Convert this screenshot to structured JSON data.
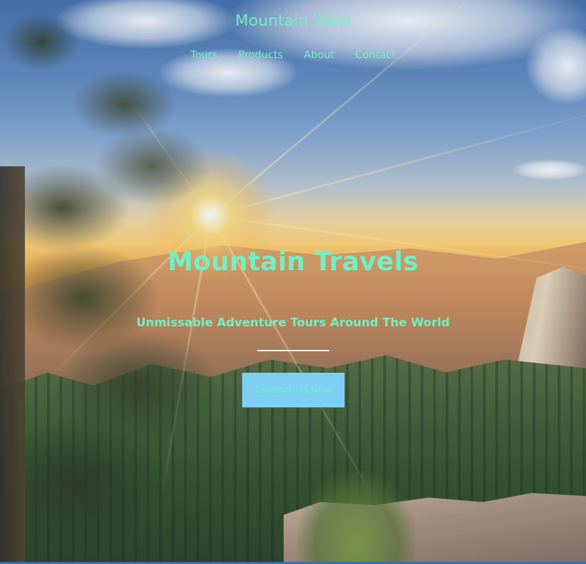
{
  "header": {
    "brand": "Mountain View",
    "nav": [
      {
        "label": "Tours"
      },
      {
        "label": "Products"
      },
      {
        "label": "About"
      },
      {
        "label": "Contact"
      }
    ]
  },
  "hero": {
    "title": "Mountain Travels",
    "tagline": "Unmissable Adventure Tours Around The World",
    "cta_label": "Contact Us Now",
    "background": "mountain-sunset-scene"
  },
  "colors": {
    "accent_text": "#6ff0c5",
    "cta_background": "#7ecff6",
    "divider": "#e9f3f5",
    "bottom_bar": "#2f6fc7"
  }
}
